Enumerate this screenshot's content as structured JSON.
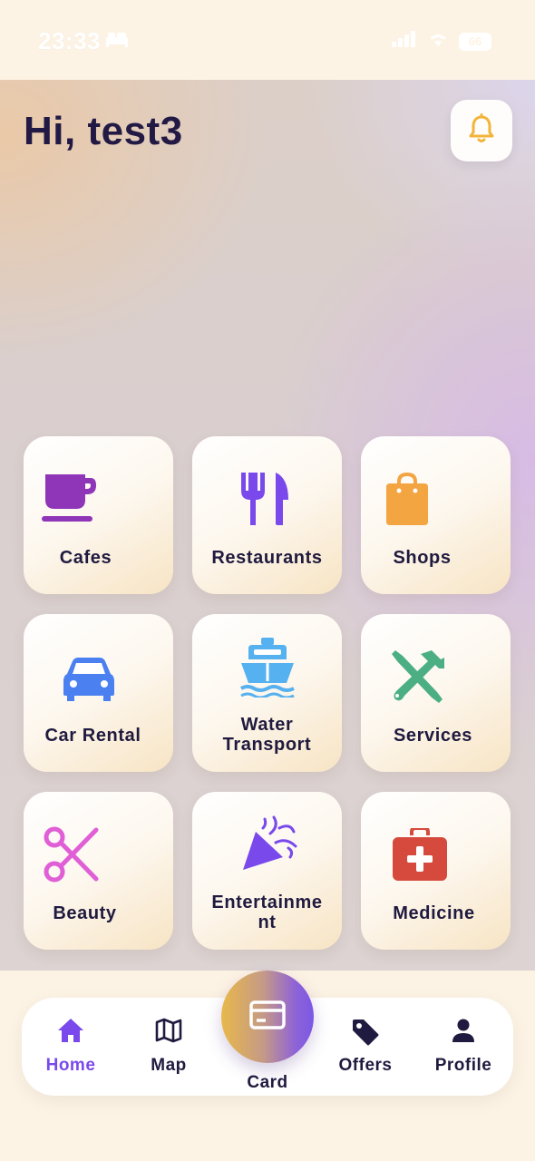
{
  "status_bar": {
    "time": "23:33",
    "battery": "66"
  },
  "header": {
    "greeting": "Hi, test3"
  },
  "categories": [
    {
      "label": "Cafes",
      "icon": "coffee-cup-icon",
      "color": "#8e35b8"
    },
    {
      "label": "Restaurants",
      "icon": "fork-knife-icon",
      "color": "#7a49ec"
    },
    {
      "label": "Shops",
      "icon": "shopping-bag-icon",
      "color": "#f2a541"
    },
    {
      "label": "Car Rental",
      "icon": "car-icon",
      "color": "#4a80f0"
    },
    {
      "label": "Water Transport",
      "label_line1": "Water",
      "label_line2": "Transport",
      "icon": "ship-icon",
      "color": "#55b1f0"
    },
    {
      "label": "Services",
      "icon": "tools-icon",
      "color": "#4caf84"
    },
    {
      "label": "Beauty",
      "icon": "scissors-icon",
      "color": "#e05fd6"
    },
    {
      "label": "Entertainment",
      "label_line1": "Entertainme",
      "label_line2": "nt",
      "icon": "party-popper-icon",
      "color": "#7a49ec"
    },
    {
      "label": "Medicine",
      "icon": "medical-kit-icon",
      "color": "#d64a3d"
    }
  ],
  "bottom_nav": {
    "items": [
      {
        "label": "Home",
        "icon": "home-icon",
        "active": true
      },
      {
        "label": "Map",
        "icon": "map-icon",
        "active": false
      },
      {
        "label": "Card",
        "icon": "credit-card-icon",
        "active": false
      },
      {
        "label": "Offers",
        "icon": "tag-icon",
        "active": false
      },
      {
        "label": "Profile",
        "icon": "person-icon",
        "active": false
      }
    ]
  },
  "colors": {
    "accent": "#7a49ec",
    "text_dark": "#221a45",
    "bell": "#f2b43a",
    "background": "#fdf3e4"
  }
}
